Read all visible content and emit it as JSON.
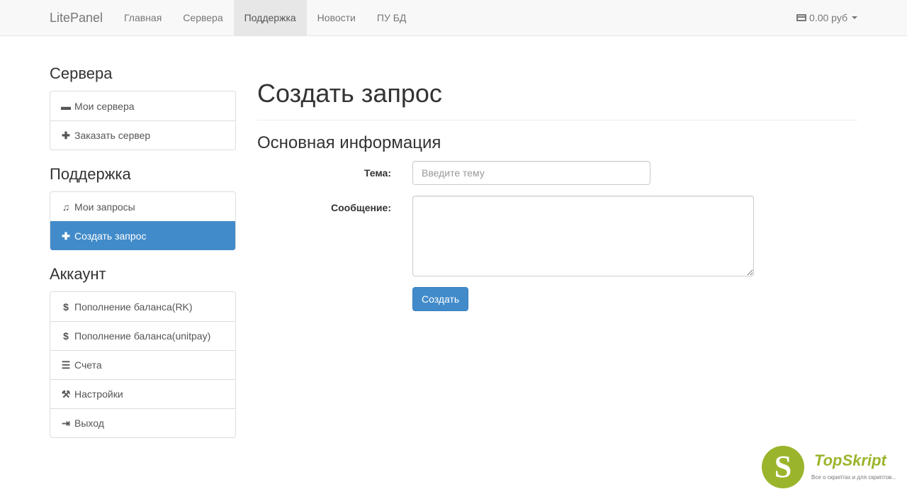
{
  "navbar": {
    "brand": "LitePanel",
    "items": [
      {
        "label": "Главная",
        "active": false
      },
      {
        "label": "Сервера",
        "active": false
      },
      {
        "label": "Поддержка",
        "active": true
      },
      {
        "label": "Новости",
        "active": false
      },
      {
        "label": "ПУ БД",
        "active": false
      }
    ],
    "balance": "0.00 руб"
  },
  "sidebar": {
    "servers": {
      "title": "Сервера",
      "items": [
        {
          "label": "Мои сервера",
          "icon": "hdd-icon"
        },
        {
          "label": "Заказать сервер",
          "icon": "plus-icon"
        }
      ]
    },
    "support": {
      "title": "Поддержка",
      "items": [
        {
          "label": "Мои запросы",
          "icon": "headphones-icon"
        },
        {
          "label": "Создать запрос",
          "icon": "plus-icon",
          "active": true
        }
      ]
    },
    "account": {
      "title": "Аккаунт",
      "items": [
        {
          "label": "Пополнение баланса(RK)",
          "icon": "dollar-icon"
        },
        {
          "label": "Пополнение баланса(unitpay)",
          "icon": "dollar-icon"
        },
        {
          "label": "Счета",
          "icon": "list-icon"
        },
        {
          "label": "Настройки",
          "icon": "wrench-icon"
        },
        {
          "label": "Выход",
          "icon": "logout-icon"
        }
      ]
    }
  },
  "main": {
    "title": "Создать запрос",
    "section_title": "Основная информация",
    "subject_label": "Тема:",
    "subject_placeholder": "Введите тему",
    "subject_value": "",
    "message_label": "Сообщение:",
    "message_value": "",
    "submit_label": "Создать"
  },
  "watermark": {
    "letter": "S",
    "name": "TopSkript",
    "tagline": "Все о скриптах и для скриптов..."
  },
  "colors": {
    "primary": "#428bca",
    "watermark_green": "#9ab52c"
  }
}
